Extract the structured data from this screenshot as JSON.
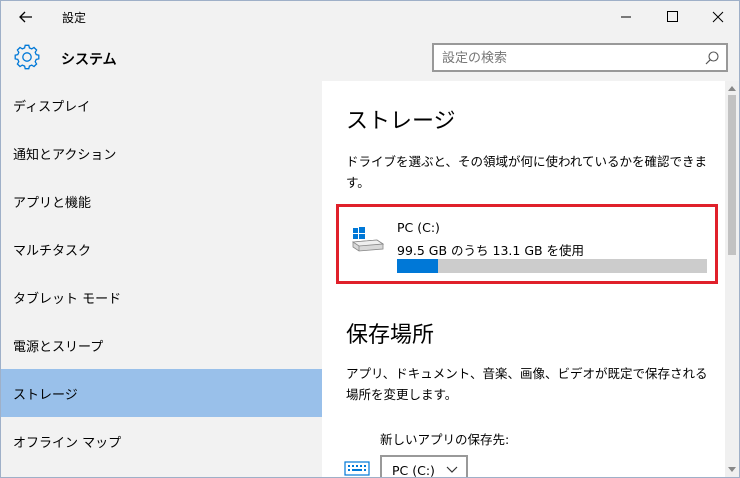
{
  "window": {
    "title": "設定"
  },
  "header": {
    "title": "システム",
    "search_placeholder": "設定の検索"
  },
  "sidebar": {
    "items": [
      {
        "label": "ディスプレイ"
      },
      {
        "label": "通知とアクション"
      },
      {
        "label": "アプリと機能"
      },
      {
        "label": "マルチタスク"
      },
      {
        "label": "タブレット モード"
      },
      {
        "label": "電源とスリープ"
      },
      {
        "label": "ストレージ",
        "selected": true
      },
      {
        "label": "オフライン マップ"
      }
    ]
  },
  "storage": {
    "title": "ストレージ",
    "description": "ドライブを選ぶと、その領域が何に使われているかを確認できます。",
    "drive": {
      "name": "PC (C:)",
      "usage_text": "99.5 GB のうち 13.1 GB を使用",
      "used_fraction": 0.1317
    }
  },
  "save_locations": {
    "title": "保存場所",
    "description": "アプリ、ドキュメント、音楽、画像、ビデオが既定で保存される場所を変更します。",
    "new_apps_label": "新しいアプリの保存先:",
    "new_apps_value": "PC (C:)"
  },
  "colors": {
    "accent": "#0078d7",
    "selected_item": "#99c0ea",
    "highlight_border": "#e0202a",
    "sidebar_bg": "#f2f2f2"
  },
  "icons": {
    "back": "back-arrow-icon",
    "settings": "gear-icon",
    "search": "search-icon",
    "drive": "drive-icon",
    "minimize": "minimize-icon",
    "maximize": "maximize-icon",
    "close": "close-icon"
  }
}
